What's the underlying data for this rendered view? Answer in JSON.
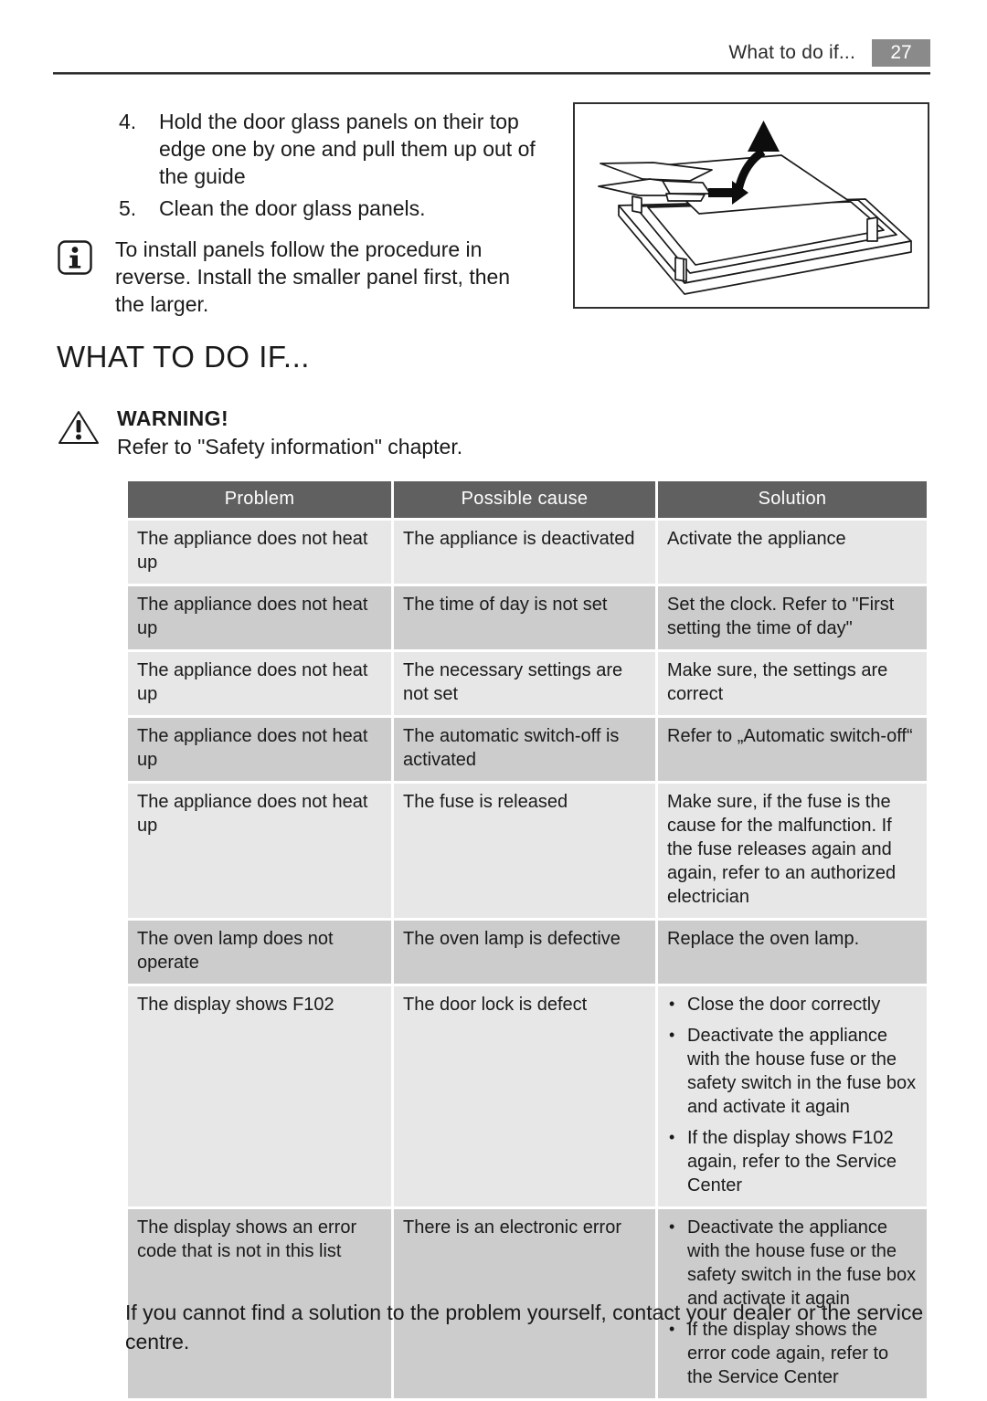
{
  "header": {
    "title": "What to do if...",
    "page_number": "27"
  },
  "upper": {
    "steps": [
      {
        "number": "4.",
        "text": "Hold the door glass panels on their top edge one by one and pull them up out of the guide"
      },
      {
        "number": "5.",
        "text": "Clean the door glass panels."
      }
    ],
    "note": {
      "icon": "info-icon",
      "text": "To install panels follow the procedure in reverse. Install the smaller panel first, then the larger."
    },
    "figure": {
      "icon": "door-glass-panel-removal-illustration",
      "caption": ""
    }
  },
  "section": {
    "heading": "WHAT TO DO IF..."
  },
  "warning": {
    "icon": "warning-triangle-icon",
    "title": "WARNING!",
    "text": "Refer to \"Safety information\" chapter."
  },
  "table": {
    "columns": [
      "Problem",
      "Possible cause",
      "Solution"
    ],
    "rows": [
      {
        "problem": "The appliance does not heat up",
        "cause": "The appliance is deactivated",
        "solution": "Activate the appliance",
        "solution_bullets": []
      },
      {
        "problem": "The appliance does not heat up",
        "cause": "The time of day is not set",
        "solution": "Set the clock. Refer to \"First setting the time of day\"",
        "solution_bullets": []
      },
      {
        "problem": "The appliance does not heat up",
        "cause": "The necessary settings are not set",
        "solution": "Make sure, the settings are correct",
        "solution_bullets": []
      },
      {
        "problem": "The appliance does not heat up",
        "cause": "The automatic switch-off is activated",
        "solution": "Refer to „Automatic switch-off“",
        "solution_bullets": []
      },
      {
        "problem": "The appliance does not heat up",
        "cause": "The fuse is released",
        "solution": "Make sure, if the fuse is the cause for the malfunction. If the fuse releases again and again, refer to an authorized electrician",
        "solution_bullets": []
      },
      {
        "problem": "The oven lamp does not operate",
        "cause": "The oven lamp is defective",
        "solution": "Replace the oven lamp.",
        "solution_bullets": []
      },
      {
        "problem": "The display shows F102",
        "cause": "The door lock is defect",
        "solution": "",
        "solution_bullets": [
          "Close the door correctly",
          "Deactivate the appliance with the house fuse or the safety switch in the fuse box and activate it again",
          "If the display shows F102 again, refer to the Service Center"
        ]
      },
      {
        "problem": "The display shows an error code that is not in this list",
        "cause": "There is an electronic error",
        "solution": "",
        "solution_bullets": [
          "Deactivate the appliance with the house fuse or the safety switch in the fuse box and activate it again",
          "If the display shows the error code again, refer to the Service Center"
        ]
      }
    ]
  },
  "closing": {
    "text": "If you cannot find a solution to the problem yourself, contact your dealer or the service centre."
  },
  "colors": {
    "header_band": "#8a8a8a",
    "table_header_bg": "#606060",
    "row_light": "#e7e7e7",
    "row_dark": "#cccccc",
    "text": "#1a1a1a"
  }
}
